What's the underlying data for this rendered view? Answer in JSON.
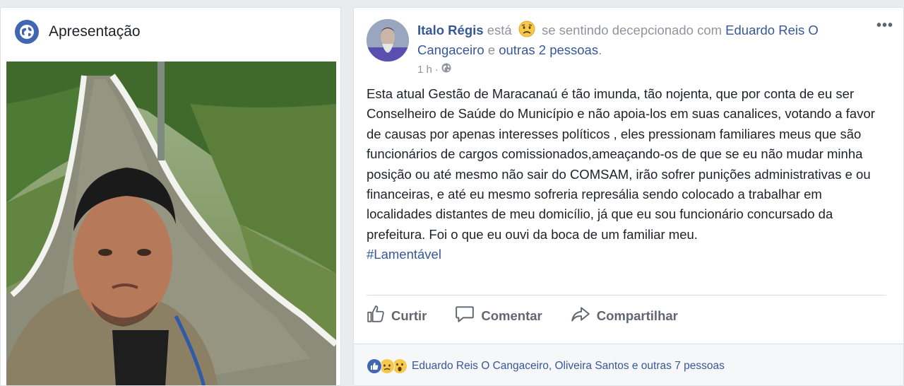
{
  "intro": {
    "title": "Apresentação",
    "icon": "globe-icon"
  },
  "post": {
    "author": "Italo Régis",
    "verb": "está",
    "feeling": "se sentindo decepcionado com",
    "tagged": "Eduardo Reis O Cangaceiro",
    "conjunction": "e",
    "others": "outras 2 pessoas",
    "period": ".",
    "time": "1 h",
    "separator": "·",
    "text": "Esta atual Gestão de Maracanaú é tão imunda, tão nojenta, que por conta de eu ser Conselheiro de Saúde do Município e não apoia-los em suas canalices, votando a favor de causas por apenas interesses políticos , eles pressionam familiares meus que são funcionários de cargos comissionados,ameaçando-os de que se eu não mudar minha posição ou até mesmo não sair do COMSAM, irão sofrer punições administrativas e ou financeiras, e até eu mesmo sofreria represália sendo colocado a trabalhar em localidades distantes de meu domicílio, já que eu sou funcionário concursado da prefeitura. Foi o que eu ouvi da boca de um familiar meu.",
    "hashtag": "#Lamentável",
    "more": "•••"
  },
  "actions": {
    "like": "Curtir",
    "comment": "Comentar",
    "share": "Compartilhar"
  },
  "reactions": {
    "text": "Eduardo Reis O Cangaceiro, Oliveira Santos e outras 7 pessoas",
    "icons": [
      "like-icon",
      "sad-icon",
      "wow-icon"
    ]
  },
  "colors": {
    "link": "#365899",
    "meta": "#90949c",
    "background": "#e9ebee",
    "like_blue": "#4267b2",
    "emoji_yellow": "#f7c94b"
  }
}
